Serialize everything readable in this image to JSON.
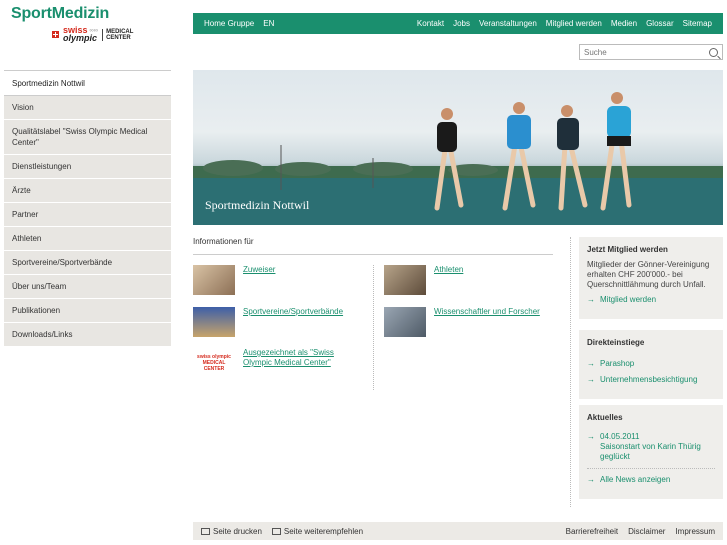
{
  "logo": {
    "title": "SportMedizin",
    "swiss": "swiss",
    "olympic": "olympic",
    "rings": "∞∞",
    "medical_center": "MEDICAL\nCENTER"
  },
  "leftnav": [
    {
      "label": "Sportmedizin Nottwil",
      "active": true
    },
    {
      "label": "Vision"
    },
    {
      "label": "Qualitätslabel \"Swiss Olympic Medical Center\""
    },
    {
      "label": "Dienstleistungen"
    },
    {
      "label": "Ärzte"
    },
    {
      "label": "Partner"
    },
    {
      "label": "Athleten"
    },
    {
      "label": "Sportvereine/Sportverbände"
    },
    {
      "label": "Über uns/Team"
    },
    {
      "label": "Publikationen"
    },
    {
      "label": "Downloads/Links"
    }
  ],
  "topbar": {
    "left": [
      "Home Gruppe",
      "EN"
    ],
    "right": [
      "Kontakt",
      "Jobs",
      "Veranstaltungen",
      "Mitglied werden",
      "Medien",
      "Glossar",
      "Sitemap"
    ]
  },
  "search": {
    "placeholder": "Suche"
  },
  "hero": {
    "title": "Sportmedizin Nottwil"
  },
  "info": {
    "heading": "Informationen für",
    "tiles": [
      {
        "label": "Zuweiser"
      },
      {
        "label": "Athleten"
      },
      {
        "label": "Sportvereine/Sportverbände"
      },
      {
        "label": "Wissenschaftler und Forscher"
      },
      {
        "label": "Ausgezeichnet als \"Swiss Olympic Medical Center\""
      }
    ],
    "badge_text": "swiss olympic MEDICAL CENTER"
  },
  "boxes": {
    "mitglied": {
      "title": "Jetzt Mitglied werden",
      "text": "Mitglieder der Gönner-Vereinigung erhalten CHF 200'000.- bei Querschnittlähmung durch Unfall.",
      "link": "Mitglied werden"
    },
    "direkt": {
      "title": "Direkteinstiege",
      "links": [
        "Parashop",
        "Unternehmensbesichtigung"
      ]
    },
    "aktuelles": {
      "title": "Aktuelles",
      "news_date": "04.05.2011",
      "news_text": "Saisonstart von Karin Thürig geglückt",
      "all_link": "Alle News anzeigen"
    }
  },
  "footer": {
    "print": "Seite drucken",
    "recommend": "Seite weiterempfehlen",
    "right": [
      "Barrierefreiheit",
      "Disclaimer",
      "Impressum"
    ]
  },
  "colors": {
    "brand_green": "#1a8f6e",
    "nav_grey": "#e8e6e2",
    "swiss_red": "#d52b1e"
  }
}
